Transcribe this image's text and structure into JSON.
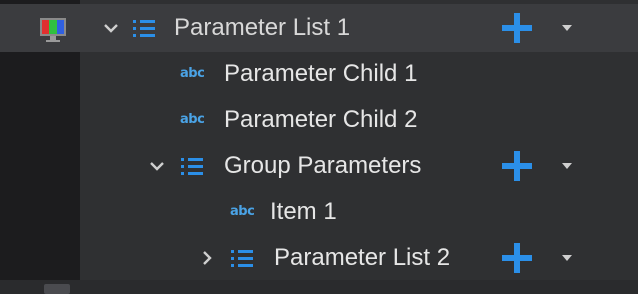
{
  "tree": {
    "rows": [
      {
        "label": "Parameter List 1",
        "type": "list",
        "expanded": true,
        "has_add": true
      },
      {
        "label": "Parameter Child 1",
        "type": "text"
      },
      {
        "label": "Parameter Child 2",
        "type": "text"
      },
      {
        "label": "Group Parameters",
        "type": "list",
        "expanded": true,
        "has_add": true
      },
      {
        "label": "Item 1",
        "type": "text"
      },
      {
        "label": "Parameter List 2",
        "type": "list",
        "expanded": false,
        "has_add": true
      }
    ],
    "type_icon_text": "abc"
  },
  "colors": {
    "accent": "#2b8fe8",
    "list_icon": "#2b8fe8",
    "text_icon": "#4aa3e6",
    "row_selected": "#3b3c3f",
    "panel_bg": "#2f3032"
  },
  "icons": {
    "app": "monitor-icon",
    "expanded": "chevron-down-icon",
    "collapsed": "chevron-right-icon",
    "list": "list-icon",
    "text": "abc-icon",
    "add": "plus-icon",
    "dropdown": "dropdown-caret-icon"
  }
}
